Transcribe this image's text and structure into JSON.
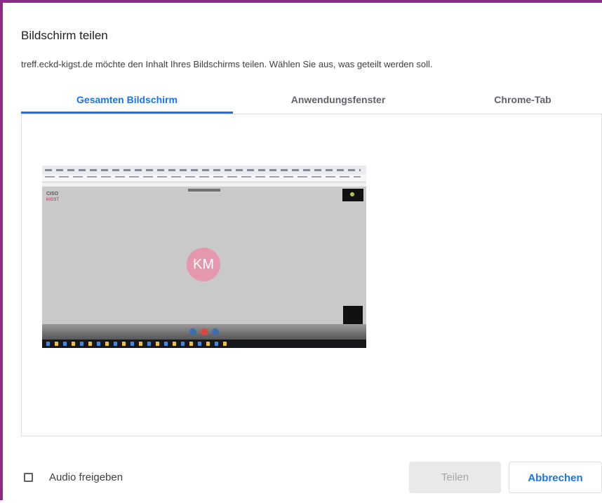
{
  "dialog": {
    "title": "Bildschirm teilen",
    "message": "treff.eckd-kigst.de möchte den Inhalt Ihres Bildschirms teilen. Wählen Sie aus, was geteilt werden soll."
  },
  "tabs": [
    {
      "label": "Gesamten Bildschirm",
      "active": true
    },
    {
      "label": "Anwendungsfenster",
      "active": false
    },
    {
      "label": "Chrome-Tab",
      "active": false
    }
  ],
  "preview": {
    "logo_text": "CISO",
    "logo_sub": "KIGST",
    "avatar_initials": "KM"
  },
  "footer": {
    "audio_label": "Audio freigeben",
    "audio_checked": false,
    "share_label": "Teilen",
    "cancel_label": "Abbrechen"
  },
  "colors": {
    "accent": "#1a73e8",
    "frame_border": "#8b2b86",
    "avatar": "#e597ad",
    "disabled_button": "#e9e9e9"
  }
}
